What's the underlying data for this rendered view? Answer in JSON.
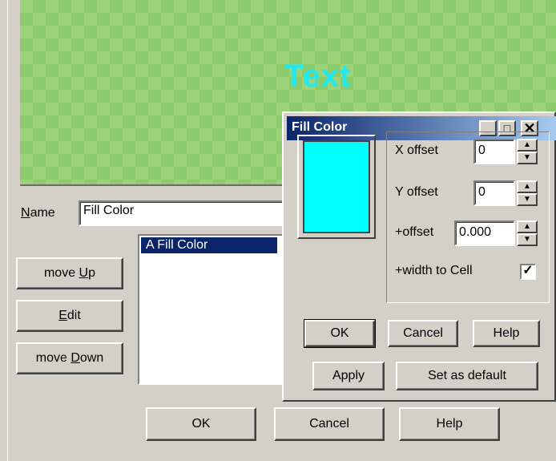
{
  "preview": {
    "text": "Text"
  },
  "name_field": {
    "label": "Name",
    "value": "Fill Color"
  },
  "layers": {
    "items": [
      "A Fill Color"
    ]
  },
  "side_buttons": {
    "move_up": "move Up",
    "edit": "Edit",
    "move_down": "move Down"
  },
  "main_buttons": {
    "ok": "OK",
    "cancel": "Cancel",
    "help": "Help"
  },
  "dialog": {
    "title": "Fill Color",
    "swatch_color": "#00ffff",
    "x_offset": {
      "label": "X offset",
      "value": "0"
    },
    "y_offset": {
      "label": "Y offset",
      "value": "0"
    },
    "plus_offset": {
      "label": "+offset",
      "value": "0.000"
    },
    "width_to_cell": {
      "label": "+width to Cell",
      "checked": true
    },
    "buttons": {
      "ok": "OK",
      "cancel": "Cancel",
      "help": "Help",
      "apply": "Apply",
      "set_default": "Set as default"
    }
  },
  "colors": {
    "title_bar": "#0a246a",
    "selection": "#0a246a",
    "preview_text": "#22e8f0"
  }
}
